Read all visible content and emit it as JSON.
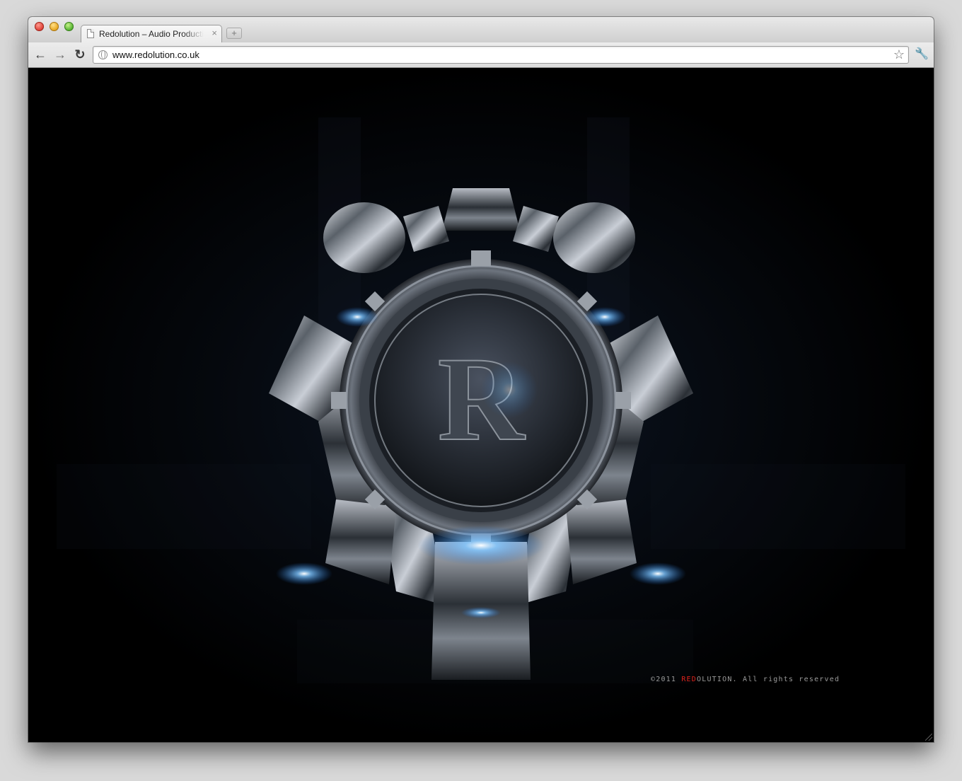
{
  "browser": {
    "tab": {
      "title": "Redolution – Audio Productions",
      "close_glyph": "×"
    },
    "new_tab_glyph": "+",
    "toolbar": {
      "back_glyph": "←",
      "forward_glyph": "→",
      "reload_glyph": "↻",
      "wrench_glyph": "🔧"
    },
    "address_bar": {
      "url": "www.redolution.co.uk",
      "star_glyph": "☆"
    }
  },
  "page": {
    "logo_letter": "R",
    "copyright": {
      "prefix": "©2011 ",
      "brand_red": "RED",
      "brand_rest": "OLUTION",
      "suffix": ". All rights reserved"
    }
  },
  "colors": {
    "brand_red": "#e0231c",
    "glow_blue": "#3aa0ff",
    "background": "#000000"
  }
}
